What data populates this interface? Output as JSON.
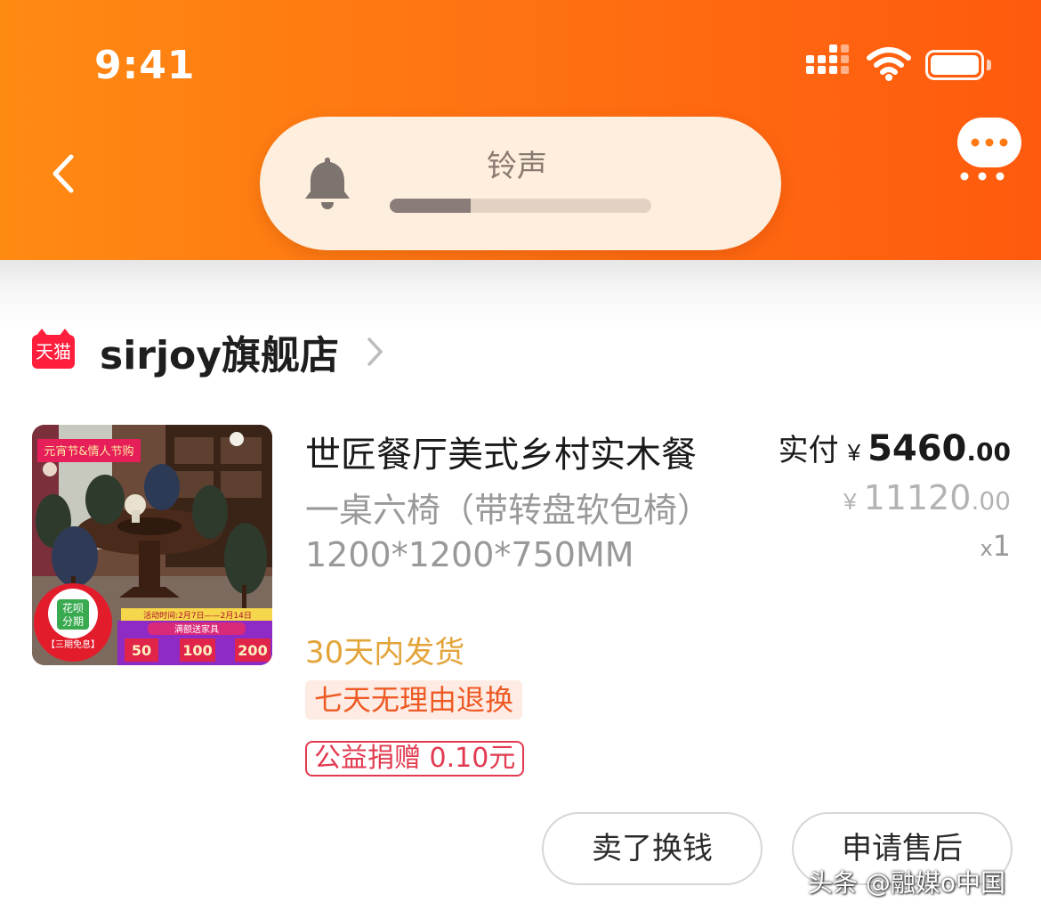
{
  "status_bar": {
    "time": "9:41",
    "icons": [
      "signal-icon",
      "wifi-icon",
      "battery-icon"
    ]
  },
  "header": {
    "back_icon": "chevron-left-icon",
    "more_icon": "chat-more-icon",
    "ringer": {
      "label": "铃声",
      "icon": "bell-icon",
      "volume_fraction": 0.31
    }
  },
  "colors": {
    "header_gradient_start": "#ff8a12",
    "header_gradient_end": "#ff5a0e",
    "tmall_red": "#ff1e3c",
    "ship_orange": "#e3a43a",
    "return_red": "#ee5a24",
    "charity_red": "#e23a50"
  },
  "store": {
    "badge": "天猫",
    "name": "sirjoy旗舰店"
  },
  "product": {
    "title": "世匠餐厅美式乡村实木餐",
    "spec": "一桌六椅（带转盘软包椅）1200*1200*750MM",
    "shipping": "30天内发货",
    "return_policy": "七天无理由退换",
    "charity": "公益捐赠 0.10元",
    "price_label": "实付",
    "price_currency": "¥",
    "price_integer": "5460",
    "price_decimal": ".00",
    "original_currency": "¥",
    "original_integer": "11120",
    "original_decimal": ".00",
    "quantity_prefix": "x",
    "quantity": "1",
    "thumbnail": {
      "banner_top": "元宵节&情人节购",
      "huabei_line1": "花呗",
      "huabei_line2": "分期",
      "huabei_note": "【三期免息】",
      "event_dates": "活动时间:2月7日——2月14日",
      "promo": "满额送家具",
      "gift_1": "50",
      "gift_2": "100",
      "gift_3": "200"
    }
  },
  "actions": {
    "sell_label": "卖了换钱",
    "aftersale_label": "申请售后"
  },
  "watermark": "头条 @融媒o中国"
}
